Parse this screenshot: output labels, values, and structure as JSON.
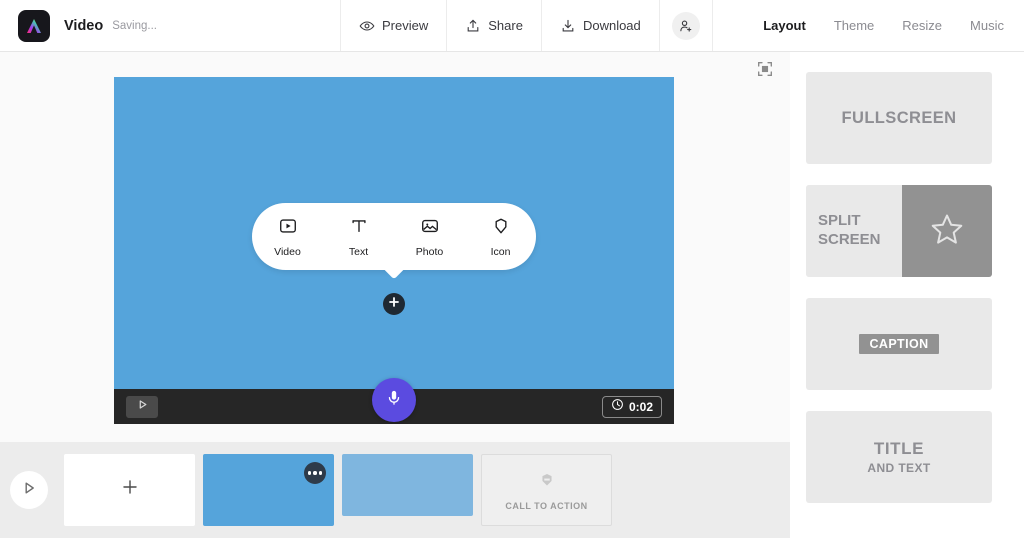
{
  "topbar": {
    "logo_icon": "adobe-express-logo-icon",
    "doc_title": "Video",
    "doc_status": "Saving...",
    "actions": [
      {
        "label": "Preview",
        "icon": "eye-icon"
      },
      {
        "label": "Share",
        "icon": "share-upload-icon"
      },
      {
        "label": "Download",
        "icon": "download-icon"
      }
    ],
    "invite_icon": "add-person-icon",
    "tabs": [
      {
        "label": "Layout",
        "active": true
      },
      {
        "label": "Theme",
        "active": false
      },
      {
        "label": "Resize",
        "active": false
      },
      {
        "label": "Music",
        "active": false
      }
    ]
  },
  "stage": {
    "expand_icon": "fullscreen-expand-icon",
    "canvas_color": "#55a4db",
    "add_menu": {
      "items": [
        {
          "label": "Video",
          "icon": "video-play-box-icon"
        },
        {
          "label": "Text",
          "icon": "text-t-icon"
        },
        {
          "label": "Photo",
          "icon": "photo-image-icon"
        },
        {
          "label": "Icon",
          "icon": "hexagon-icon"
        }
      ]
    },
    "add_button_icon": "plus-icon",
    "controls": {
      "play_icon": "play-icon",
      "mic_icon": "microphone-icon",
      "mic_color": "#5b4be0",
      "timer_icon": "clock-icon",
      "timer": "0:02"
    }
  },
  "right_panel": {
    "layouts": [
      {
        "name": "fullscreen",
        "label": "FULLSCREEN"
      },
      {
        "name": "split-screen",
        "label_line1": "SPLIT",
        "label_line2": "SCREEN",
        "preview_icon": "star-icon"
      },
      {
        "name": "caption",
        "label": "CAPTION"
      },
      {
        "name": "title-and-text",
        "label_line1": "TITLE",
        "label_line2": "AND TEXT"
      }
    ]
  },
  "timeline": {
    "play_icon": "play-icon",
    "items": [
      {
        "name": "add-scene",
        "type": "add",
        "icon": "plus-icon"
      },
      {
        "name": "scene-1",
        "type": "blue",
        "menu_icon": "more-options-icon"
      },
      {
        "name": "scene-2",
        "type": "blue-light"
      },
      {
        "name": "call-to-action",
        "type": "cta",
        "label": "CALL TO ACTION",
        "icon": "badge-hexagon-icon"
      }
    ]
  }
}
